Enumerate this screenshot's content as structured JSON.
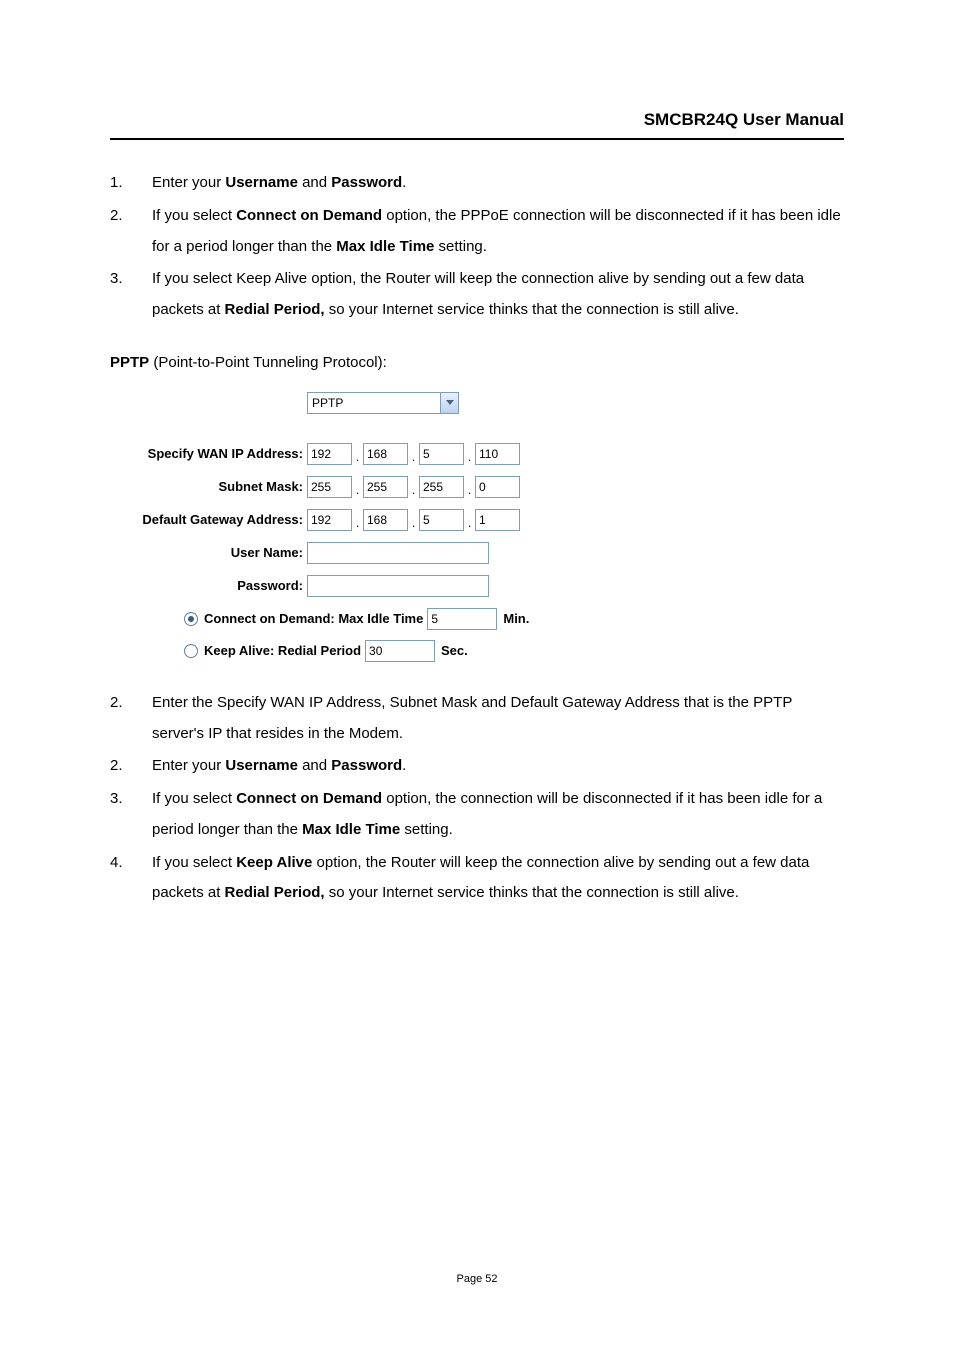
{
  "header": {
    "title": "SMCBR24Q User Manual"
  },
  "list1": [
    {
      "n": "1.",
      "parts": [
        "Enter your ",
        {
          "b": "Username"
        },
        " and ",
        {
          "b": "Password"
        },
        "."
      ]
    },
    {
      "n": "2.",
      "parts": [
        "If you select ",
        {
          "b": "Connect on Demand"
        },
        " option, the PPPoE connection will be disconnected if it has been idle for a period longer than the ",
        {
          "b": "Max Idle Time"
        },
        " setting."
      ]
    },
    {
      "n": "3.",
      "parts": [
        "If you select Keep Alive option, the Router will keep the connection alive by sending out a few data packets at ",
        {
          "b": "Redial Period,"
        },
        " so your Internet service thinks that the connection is still alive."
      ]
    }
  ],
  "pptp_intro": {
    "bold": "PPTP",
    "rest": " (Point-to-Point Tunneling Protocol):"
  },
  "form": {
    "select_value": "PPTP",
    "wan_label": "Specify WAN IP Address:",
    "wan": [
      "192",
      "168",
      "5",
      "110"
    ],
    "mask_label": "Subnet Mask:",
    "mask": [
      "255",
      "255",
      "255",
      "0"
    ],
    "gw_label": "Default Gateway Address:",
    "gw": [
      "192",
      "168",
      "5",
      "1"
    ],
    "user_label": "User Name:",
    "pass_label": "Password:",
    "cod_label": "Connect on Demand: Max Idle Time",
    "cod_value": "5",
    "cod_unit": "Min.",
    "ka_label": "Keep Alive: Redial Period",
    "ka_value": "30",
    "ka_unit": "Sec."
  },
  "list2": [
    {
      "n": "2.",
      "parts": [
        "Enter the Specify WAN IP Address, Subnet Mask and Default Gateway Address that is the PPTP server's IP that resides in the Modem."
      ]
    },
    {
      "n": "2.",
      "parts": [
        "Enter your ",
        {
          "b": "Username"
        },
        " and ",
        {
          "b": "Password"
        },
        "."
      ]
    },
    {
      "n": "3.",
      "parts": [
        "If you select ",
        {
          "b": "Connect on Demand"
        },
        " option, the connection will be disconnected if it has been idle for a period longer than the ",
        {
          "b": "Max Idle Time"
        },
        " setting."
      ]
    },
    {
      "n": "4.",
      "parts": [
        "If you select ",
        {
          "b": "Keep Alive"
        },
        " option, the Router will keep the connection alive by sending out a few data packets at ",
        {
          "b": "Redial Period,"
        },
        " so your Internet service thinks that the connection is still alive."
      ]
    }
  ],
  "footer": {
    "page": "Page 52"
  }
}
